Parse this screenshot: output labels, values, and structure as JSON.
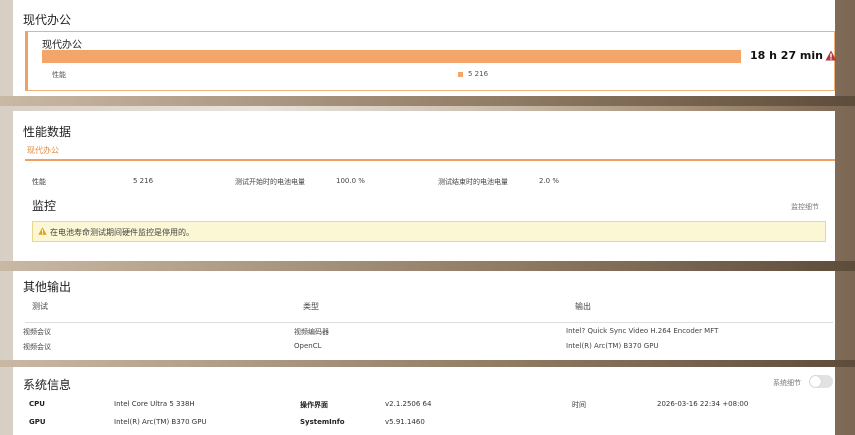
{
  "battery": {
    "title": "现代办公",
    "item_title": "现代办公",
    "duration": "18 h 27 min",
    "perf_label": "性能",
    "perf_value": "5 216",
    "bar_color": "#f4a66a"
  },
  "perf_data": {
    "title": "性能数据",
    "tab": "现代办公",
    "perf_label": "性能",
    "perf_value": "5 216",
    "start_label": "测试开始时的电池电量",
    "start_value": "100.0 %",
    "end_label": "测试结束时的电池电量",
    "end_value": "2.0 %",
    "monitor_title": "监控",
    "monitor_link": "监控细节",
    "alert_text": "在电池寿命测试期间硬件监控是停用的。"
  },
  "other_output": {
    "title": "其他输出",
    "headers": [
      "测试",
      "类型",
      "输出"
    ],
    "rows": [
      [
        "视频会议",
        "视频编码器",
        "Intel? Quick Sync Video H.264 Encoder MFT"
      ],
      [
        "视频会议",
        "OpenCL",
        "Intel(R) Arc(TM) B370 GPU"
      ]
    ]
  },
  "system_info": {
    "title": "系统信息",
    "toggle_label": "系统细节",
    "cpu_label": "CPU",
    "cpu_value": "Intel Core Ultra 5 338H",
    "os_label": "操作界面",
    "os_value": "v2.1.2506 64",
    "time_label": "时间",
    "time_value": "2026-03-16 22:34 +08:00",
    "gpu_label": "GPU",
    "gpu_value": "Intel(R) Arc(TM) B370 GPU",
    "sysinfo_label": "SystemInfo",
    "sysinfo_value": "v5.91.1460"
  }
}
